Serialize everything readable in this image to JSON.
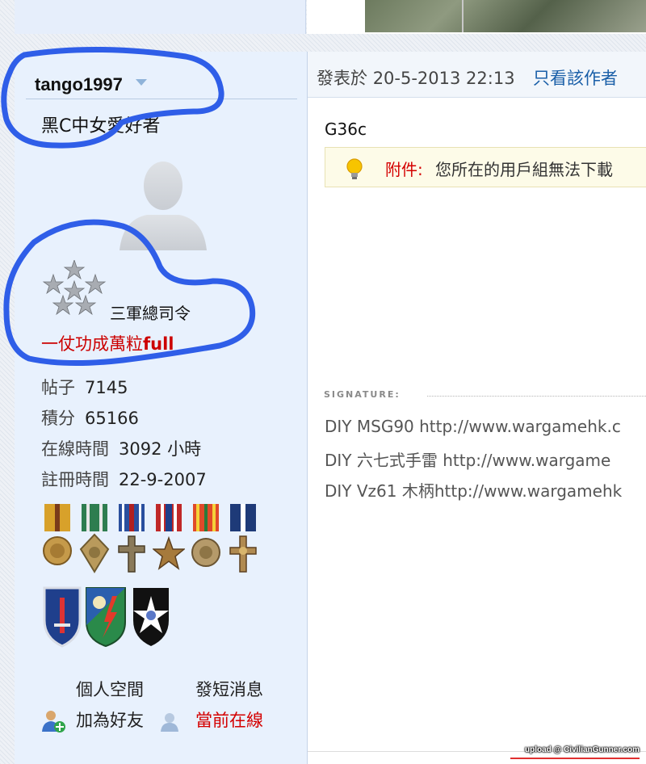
{
  "user": {
    "username": "tango1997",
    "custom_title": "黑C中女愛好者",
    "rank_name": "三軍總司令",
    "group_name_prefix": "一仗功成萬粒",
    "group_name_suffix": "full",
    "stats": [
      {
        "label": "帖子",
        "value": "7145"
      },
      {
        "label": "積分",
        "value": "65166"
      },
      {
        "label": "在線時間",
        "value": "3092 小時"
      },
      {
        "label": "註冊時間",
        "value": "22-9-2007"
      }
    ],
    "medals": [
      "gold-medal-icon",
      "green-medal-icon",
      "cross-medal-icon",
      "star-medal-icon",
      "striped-medal-icon",
      "navy-cross-icon"
    ],
    "patches": [
      "sword-patch-icon",
      "ranger-patch-icon",
      "star-patch-icon"
    ],
    "actions": {
      "personal_space": "個人空間",
      "send_message": "發短消息",
      "add_friend": "加為好友",
      "online_status": "當前在線"
    }
  },
  "post": {
    "date_prefix": "發表於",
    "date": "20-5-2013 22:13",
    "only_author": "只看該作者",
    "content": "G36c",
    "attachment_label": "附件:",
    "attachment_text": "您所在的用戶組無法下載",
    "signature_label": "SIGNATURE:",
    "signature_lines": [
      "DIY MSG90 http://www.wargamehk.c",
      "DIY 六七式手雷 http://www.wargame",
      "DIY Vz61 木柄http://www.wargamehk"
    ]
  },
  "watermark": "upload @ CivilianGunner.com",
  "colors": {
    "annotation": "#2f5ee8",
    "link": "#1a5fa8",
    "alert": "#d40000"
  }
}
